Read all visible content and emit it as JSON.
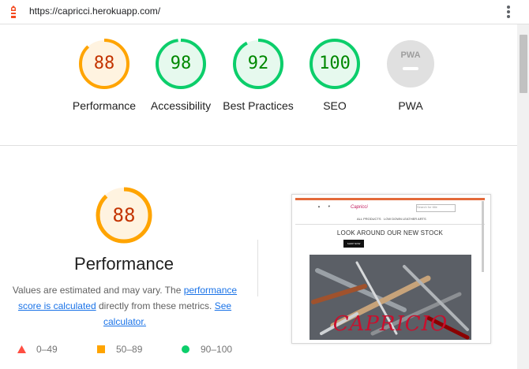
{
  "browser": {
    "url": "https://capricci.herokuapp.com/"
  },
  "colors": {
    "average": "#ffa400",
    "average_text": "#c33300",
    "pass": "#0cce6b",
    "pass_text": "#008800",
    "fail": "#ff4e42",
    "na": "#e0e0e0",
    "link": "#1a73e8"
  },
  "categories": [
    {
      "label": "Performance",
      "score": "88",
      "status": "average"
    },
    {
      "label": "Accessibility",
      "score": "98",
      "status": "pass"
    },
    {
      "label": "Best Practices",
      "score": "92",
      "status": "pass"
    },
    {
      "label": "SEO",
      "score": "100",
      "status": "pass"
    },
    {
      "label": "PWA",
      "score": "",
      "status": "na"
    }
  ],
  "performance": {
    "score": "88",
    "title": "Performance",
    "desc_prefix": "Values are estimated and may vary. The ",
    "desc_link1": "performance score is calculated",
    "desc_middle": " directly from these metrics. ",
    "desc_link2": "See calculator.",
    "legend": [
      {
        "range": "0–49",
        "icon": "red-triangle-icon"
      },
      {
        "range": "50–89",
        "icon": "orange-square-icon"
      },
      {
        "range": "90–100",
        "icon": "green-circle-icon"
      }
    ]
  },
  "thumbnail": {
    "heading": "LOOK AROUND OUR NEW STOCK",
    "button": "SHOP NOW",
    "brand": "Capricci",
    "search_placeholder": "Search for title",
    "menu1": "ALL PRODUCTS",
    "menu2": "LOW DOWN LEATHER ARTS",
    "hero_text": "CAPRICIO"
  }
}
